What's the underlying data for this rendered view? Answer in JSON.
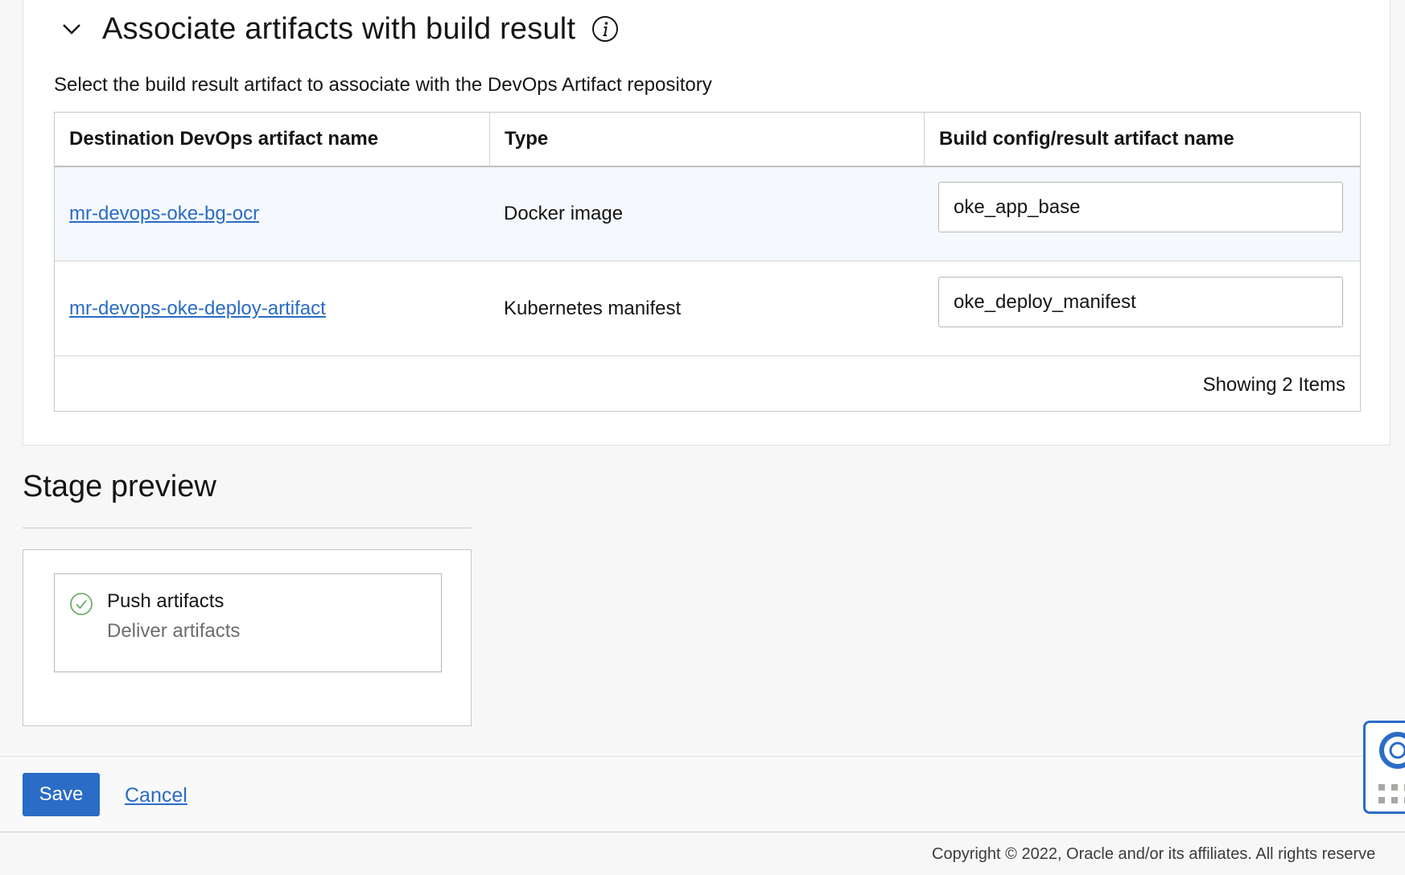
{
  "section": {
    "title": "Associate artifacts with build result",
    "description": "Select the build result artifact to associate with the DevOps Artifact repository"
  },
  "table": {
    "columns": [
      "Destination DevOps artifact name",
      "Type",
      "Build config/result artifact name"
    ],
    "rows": [
      {
        "artifact": "mr-devops-oke-bg-ocr",
        "type": "Docker image",
        "result_name": "oke_app_base"
      },
      {
        "artifact": "mr-devops-oke-deploy-artifact",
        "type": "Kubernetes manifest",
        "result_name": "oke_deploy_manifest"
      }
    ],
    "footer": "Showing 2 Items"
  },
  "stage_preview": {
    "title": "Stage preview",
    "stage_name": "Push artifacts",
    "stage_description": "Deliver artifacts"
  },
  "actions": {
    "save_label": "Save",
    "cancel_label": "Cancel"
  },
  "copyright": "Copyright © 2022, Oracle and/or its affiliates. All rights reserve",
  "icons": {
    "chevron": "chevron-down-icon",
    "info": "info-icon",
    "check": "check-circle-icon",
    "help": "help-lifebuoy-icon"
  },
  "colors": {
    "accent": "#2a6cc6",
    "success": "#5fa85b"
  }
}
